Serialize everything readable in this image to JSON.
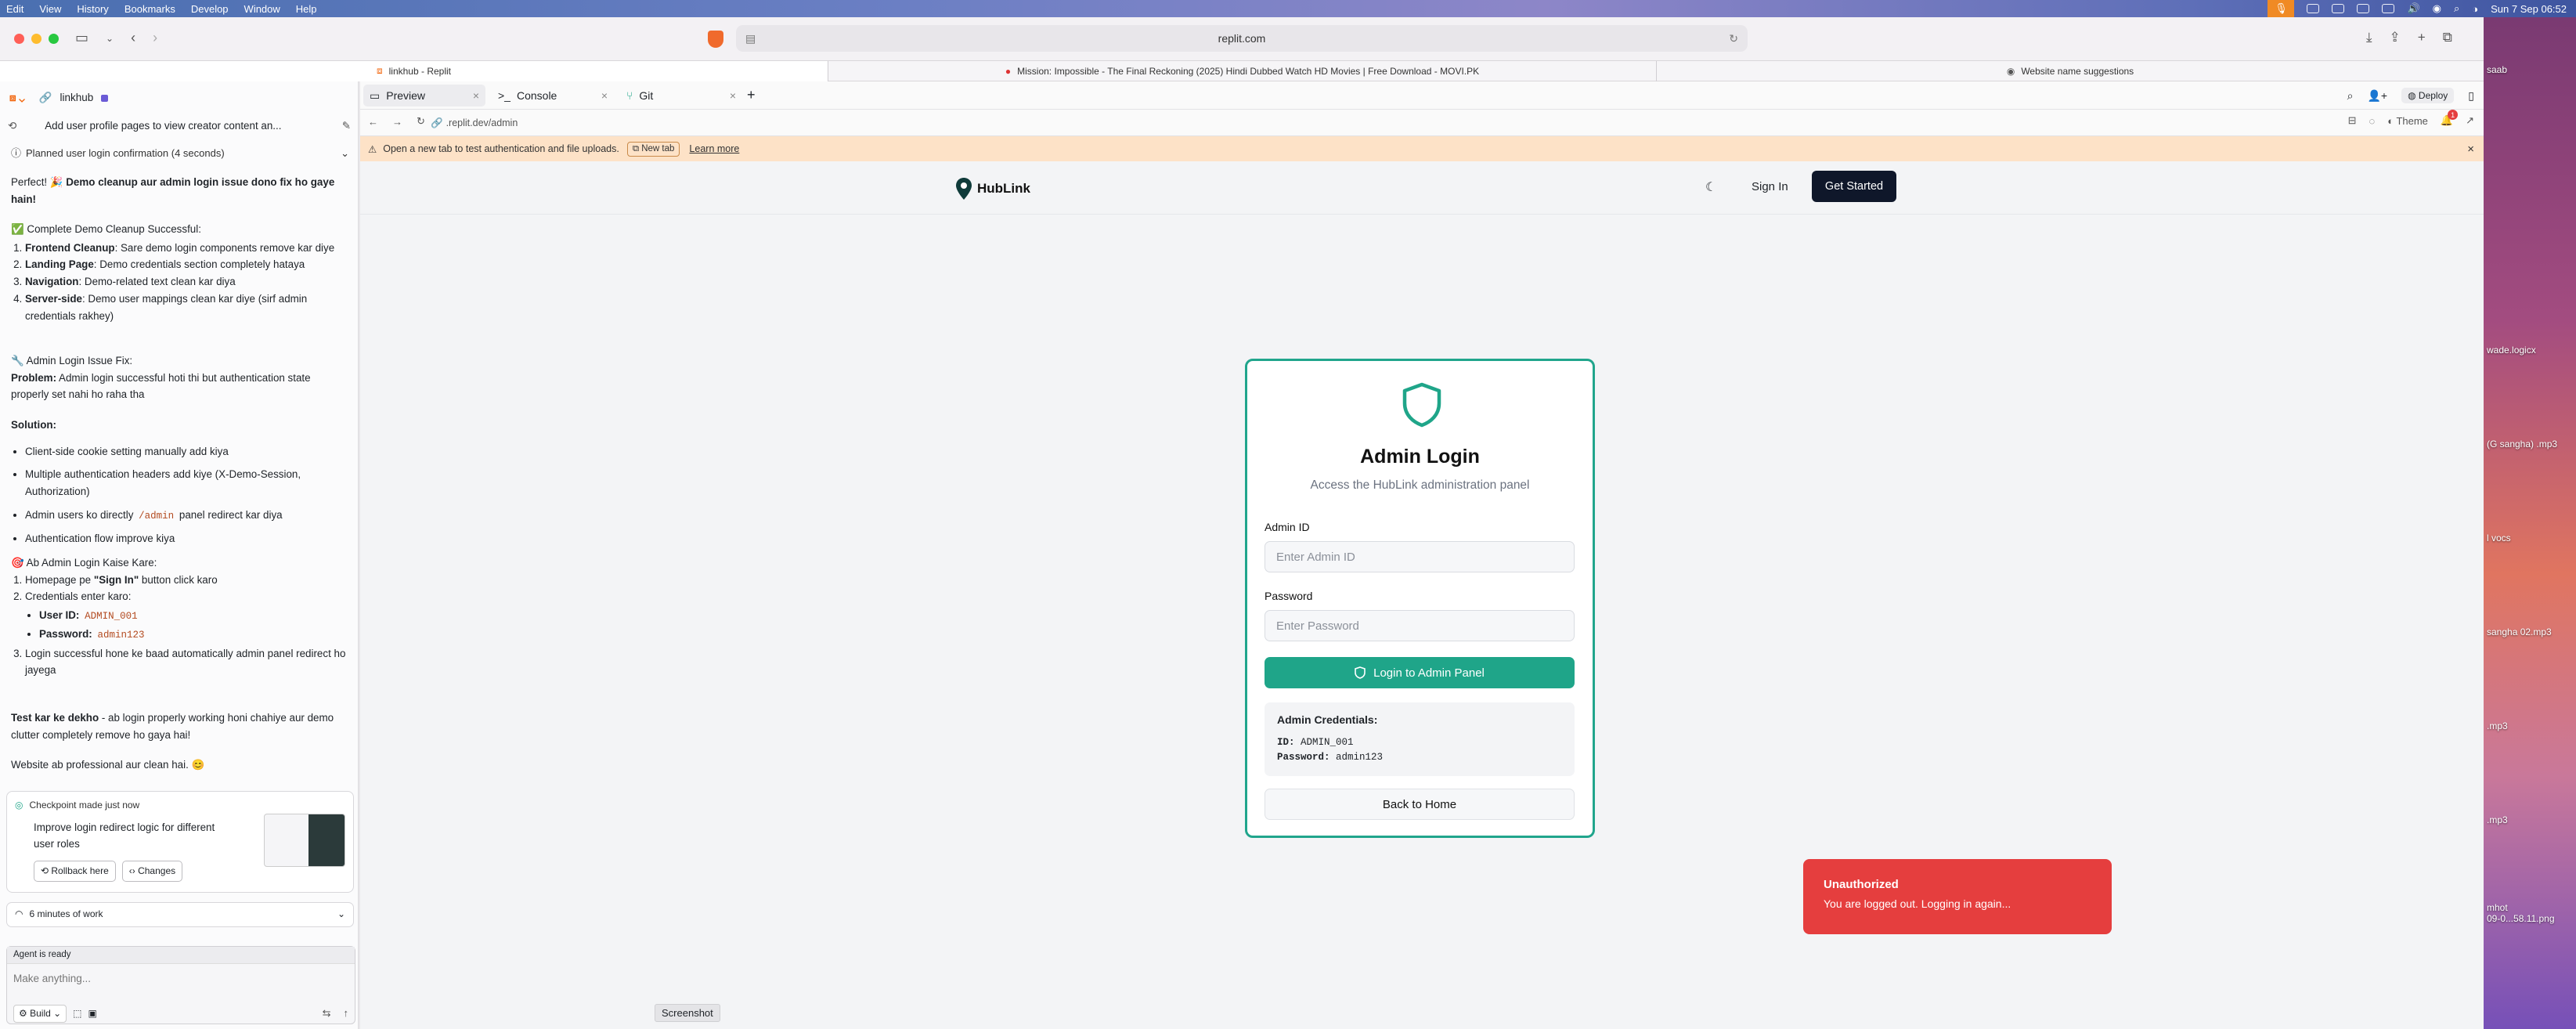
{
  "menubar": {
    "items": [
      "Edit",
      "View",
      "History",
      "Bookmarks",
      "Develop",
      "Window",
      "Help"
    ],
    "clock": "Sun 7 Sep  06:52"
  },
  "browser": {
    "url": "replit.com",
    "tabs": [
      {
        "label": "linkhub - Replit"
      },
      {
        "label": "Mission: Impossible - The Final Reckoning (2025) Hindi Dubbed Watch HD Movies | Free Download - MOVI.PK"
      },
      {
        "label": "Website name suggestions"
      }
    ]
  },
  "left": {
    "project": "linkhub",
    "task_title": "Add user profile pages to view creator content an...",
    "planned": "Planned user login confirmation (4 seconds)",
    "intro_plain": "Perfect! 🎉 ",
    "intro_bold": "Demo cleanup aur admin login issue dono fix ho gaye hain!",
    "cleanup_heading": "✅ Complete Demo Cleanup Successful:",
    "cleanup_items": [
      {
        "k": "Frontend Cleanup",
        "v": ": Sare demo login components remove kar diye"
      },
      {
        "k": "Landing Page",
        "v": ": Demo credentials section completely hataya"
      },
      {
        "k": "Navigation",
        "v": ": Demo-related text clean kar diya"
      },
      {
        "k": "Server-side",
        "v": ": Demo user mappings clean kar diye (sirf admin credentials rakhey)"
      }
    ],
    "fix_heading": "🔧 Admin Login Issue Fix:",
    "problem_label": "Problem:",
    "problem_text": " Admin login successful hoti thi but authentication state properly set nahi ho raha tha",
    "solution_label": "Solution:",
    "solution_items": [
      "Client-side cookie setting manually add kiya",
      "Multiple authentication headers add kiye (X-Demo-Session, Authorization)",
      "Authentication flow improve kiya"
    ],
    "solution_item3_pre": "Admin users ko directly ",
    "solution_item3_code": "/admin",
    "solution_item3_post": " panel redirect kar diya",
    "how_heading": "🎯 Ab Admin Login Kaise Kare:",
    "how_1_pre": "Homepage pe ",
    "how_1_bold": "\"Sign In\"",
    "how_1_post": " button click karo",
    "how_2": "Credentials enter karo:",
    "user_id_label": "User ID:",
    "user_id_value": "ADMIN_001",
    "password_label": "Password:",
    "password_value": "admin123",
    "how_3": "Login successful hone ke baad automatically admin panel redirect ho jayega",
    "test_bold": "Test kar ke dekho",
    "test_text": " - ab login properly working honi chahiye aur demo clutter completely remove ho gaya hai!",
    "final_text": "Website ab professional aur clean hai. 😊",
    "checkpoint_label": "Checkpoint made just now",
    "checkpoint_title": "Improve login redirect logic for different user roles",
    "rollback_label": "Rollback here",
    "changes_label": "Changes",
    "work_label": "6 minutes of work",
    "agent_status": "Agent is ready",
    "input_placeholder": "Make anything...",
    "build_label": "Build"
  },
  "app": {
    "tabs": [
      "Preview",
      "Console",
      "Git"
    ],
    "deploy_label": "Deploy",
    "address_host": "",
    "address_path": ".replit.dev/admin",
    "theme_label": "Theme",
    "notif_count": "1",
    "banner_text": "Open a new tab to test authentication and file uploads.",
    "banner_newtab": "New tab",
    "banner_learn": "Learn more",
    "site": {
      "logo_text": "HubLink",
      "signin": "Sign In",
      "get_started": "Get Started"
    },
    "login": {
      "title": "Admin Login",
      "subtitle": "Access the HubLink administration panel",
      "admin_id_label": "Admin ID",
      "admin_id_placeholder": "Enter Admin ID",
      "password_label": "Password",
      "password_placeholder": "Enter Password",
      "submit": "Login to Admin Panel",
      "creds_heading": "Admin Credentials:",
      "creds_id_label": "ID:",
      "creds_id": "ADMIN_001",
      "creds_pw_label": "Password:",
      "creds_pw": "admin123",
      "back": "Back to Home"
    },
    "toast": {
      "title": "Unauthorized",
      "message": "You are logged out. Logging in again..."
    },
    "screenshot_label": "Screenshot"
  },
  "desktop": {
    "files": [
      "saab",
      "wade.logicx",
      "(G sangha) .mp3",
      "l vocs",
      "sangha 02.mp3",
      ".mp3",
      ".mp3",
      "mhot\n09-0...58.11.png"
    ]
  },
  "colors": {
    "accent": "#1fa589",
    "toast": "#e53e3e",
    "banner": "#fde2c7",
    "dark_button": "#0f172a"
  }
}
